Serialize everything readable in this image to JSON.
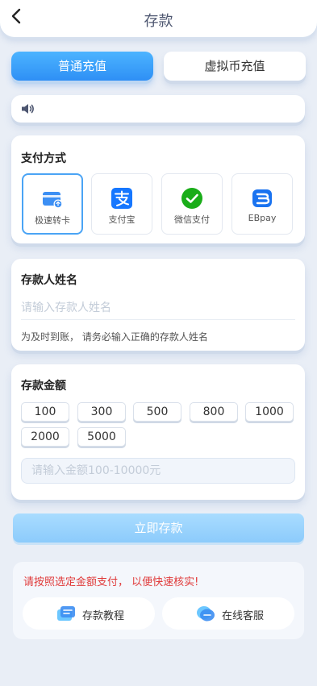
{
  "header": {
    "title": "存款"
  },
  "tabs": [
    {
      "label": "普通充值",
      "active": true
    },
    {
      "label": "虚拟币充值",
      "active": false
    }
  ],
  "notice": {
    "icon": "speaker-icon",
    "text": ""
  },
  "payment": {
    "title": "支付方式",
    "methods": [
      {
        "label": "极速转卡",
        "icon": "bank-card-icon",
        "selected": true
      },
      {
        "label": "支付宝",
        "icon": "alipay-icon",
        "selected": false
      },
      {
        "label": "微信支付",
        "icon": "wechat-pay-icon",
        "selected": false
      },
      {
        "label": "EBpay",
        "icon": "ebpay-icon",
        "selected": false
      }
    ]
  },
  "depositor": {
    "title": "存款人姓名",
    "placeholder": "请输入存款人姓名",
    "value": "",
    "hint": "为及时到账， 请务必输入正确的存款人姓名"
  },
  "amount": {
    "title": "存款金额",
    "options": [
      "100",
      "300",
      "500",
      "800",
      "1000",
      "2000",
      "5000"
    ],
    "placeholder": "请输入金额100-10000元",
    "value": ""
  },
  "submit_label": "立即存款",
  "footer": {
    "warning": "请按照选定金额支付， 以便快速核实!",
    "tutorial_label": "存款教程",
    "support_label": "在线客服"
  },
  "colors": {
    "accent": "#2e8ff5",
    "background": "#e9eef6",
    "warning": "#e03a3a",
    "submit_disabled": "#9ad2fc"
  }
}
